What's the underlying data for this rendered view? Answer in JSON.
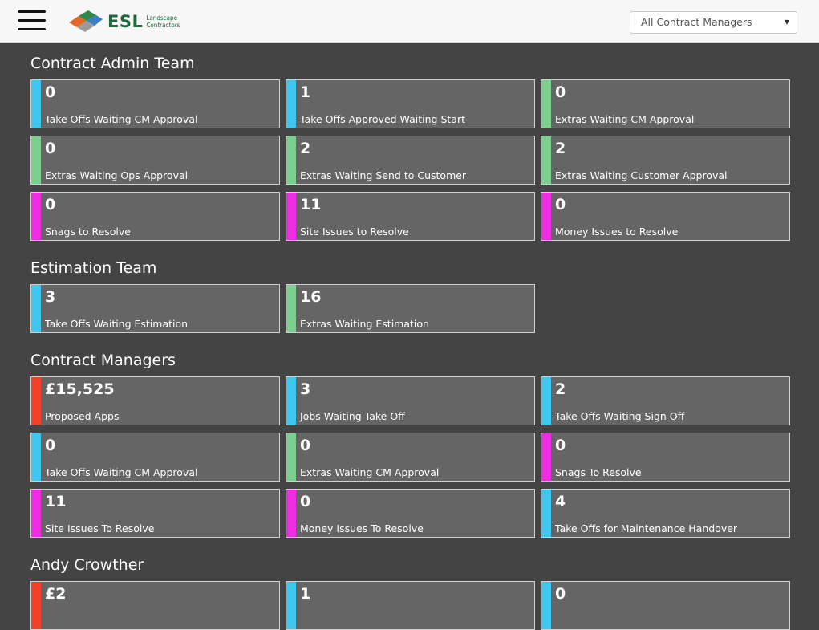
{
  "header": {
    "logo_main": "ESL",
    "logo_sub1": "Landscape",
    "logo_sub2": "Contractors",
    "select_value": "All Contract Managers"
  },
  "colors": {
    "blue": "#3ec6ef",
    "green": "#7ccf8e",
    "magenta": "#ee2ce1",
    "red": "#f0412a"
  },
  "sections": [
    {
      "title": "Contract Admin Team",
      "tiles": [
        {
          "value": "0",
          "label": "Take Offs Waiting CM Approval",
          "color": "blue"
        },
        {
          "value": "1",
          "label": "Take Offs Approved Waiting Start",
          "color": "blue"
        },
        {
          "value": "0",
          "label": "Extras Waiting CM Approval",
          "color": "green"
        },
        {
          "value": "0",
          "label": "Extras Waiting Ops Approval",
          "color": "green"
        },
        {
          "value": "2",
          "label": "Extras Waiting Send to Customer",
          "color": "green"
        },
        {
          "value": "2",
          "label": "Extras Waiting Customer Approval",
          "color": "green"
        },
        {
          "value": "0",
          "label": "Snags to Resolve",
          "color": "magenta"
        },
        {
          "value": "11",
          "label": "Site Issues to Resolve",
          "color": "magenta"
        },
        {
          "value": "0",
          "label": "Money Issues to Resolve",
          "color": "magenta"
        }
      ]
    },
    {
      "title": "Estimation Team",
      "tiles": [
        {
          "value": "3",
          "label": "Take Offs Waiting Estimation",
          "color": "blue"
        },
        {
          "value": "16",
          "label": "Extras Waiting Estimation",
          "color": "green"
        }
      ]
    },
    {
      "title": "Contract Managers",
      "tiles": [
        {
          "value": "£15,525",
          "label": "Proposed Apps",
          "color": "red"
        },
        {
          "value": "3",
          "label": "Jobs Waiting Take Off",
          "color": "blue"
        },
        {
          "value": "2",
          "label": "Take Offs Waiting Sign Off",
          "color": "blue"
        },
        {
          "value": "0",
          "label": "Take Offs Waiting CM Approval",
          "color": "blue"
        },
        {
          "value": "0",
          "label": "Extras Waiting CM Approval",
          "color": "green"
        },
        {
          "value": "0",
          "label": "Snags To Resolve",
          "color": "magenta"
        },
        {
          "value": "11",
          "label": "Site Issues To Resolve",
          "color": "magenta"
        },
        {
          "value": "0",
          "label": "Money Issues To Resolve",
          "color": "magenta"
        },
        {
          "value": "4",
          "label": "Take Offs for Maintenance Handover",
          "color": "blue"
        }
      ]
    },
    {
      "title": "Andy Crowther",
      "tiles": [
        {
          "value": "£2",
          "label": "",
          "color": "red"
        },
        {
          "value": "1",
          "label": "",
          "color": "blue"
        },
        {
          "value": "0",
          "label": "",
          "color": "blue"
        }
      ]
    }
  ]
}
